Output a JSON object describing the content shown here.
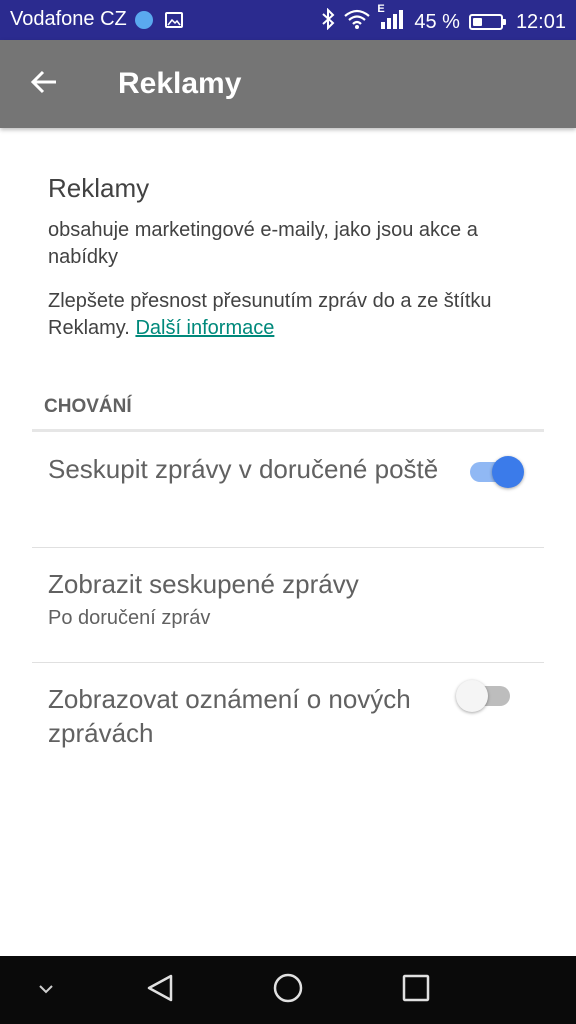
{
  "status_bar": {
    "carrier": "Vodafone CZ",
    "network_type": "E",
    "battery_percent": "45 %",
    "battery_level": 0.45,
    "time": "12:01"
  },
  "app_bar": {
    "title": "Reklamy"
  },
  "category_info": {
    "title": "Reklamy",
    "description": "obsahuje marketingové e-maily, jako jsou akce a nabídky",
    "hint": "Zlepšete přesnost přesunutím zpráv do a ze štítku Reklamy.",
    "link_label": "Další informace"
  },
  "behavior": {
    "header": "CHOVÁNÍ",
    "items": [
      {
        "title": "Seskupit zprávy v doručené poště",
        "switch_on": true
      },
      {
        "title": "Zobrazit seskupené zprávy",
        "summary": "Po doručení zpráv"
      },
      {
        "title": "Zobrazovat oznámení o nových zprávách",
        "switch_on": false
      }
    ]
  },
  "icons": {
    "back": "arrow-back-icon",
    "bluetooth": "bluetooth-icon",
    "wifi": "wifi-icon",
    "signal": "signal-icon",
    "battery": "battery-icon",
    "nav_down": "chevron-down-icon",
    "nav_back": "nav-back-icon",
    "nav_home": "nav-home-icon",
    "nav_recents": "nav-recents-icon"
  },
  "colors": {
    "status_bar": "#2b2b8f",
    "app_bar": "#757575",
    "link": "#00897b",
    "switch_on": "#3b7bea"
  }
}
